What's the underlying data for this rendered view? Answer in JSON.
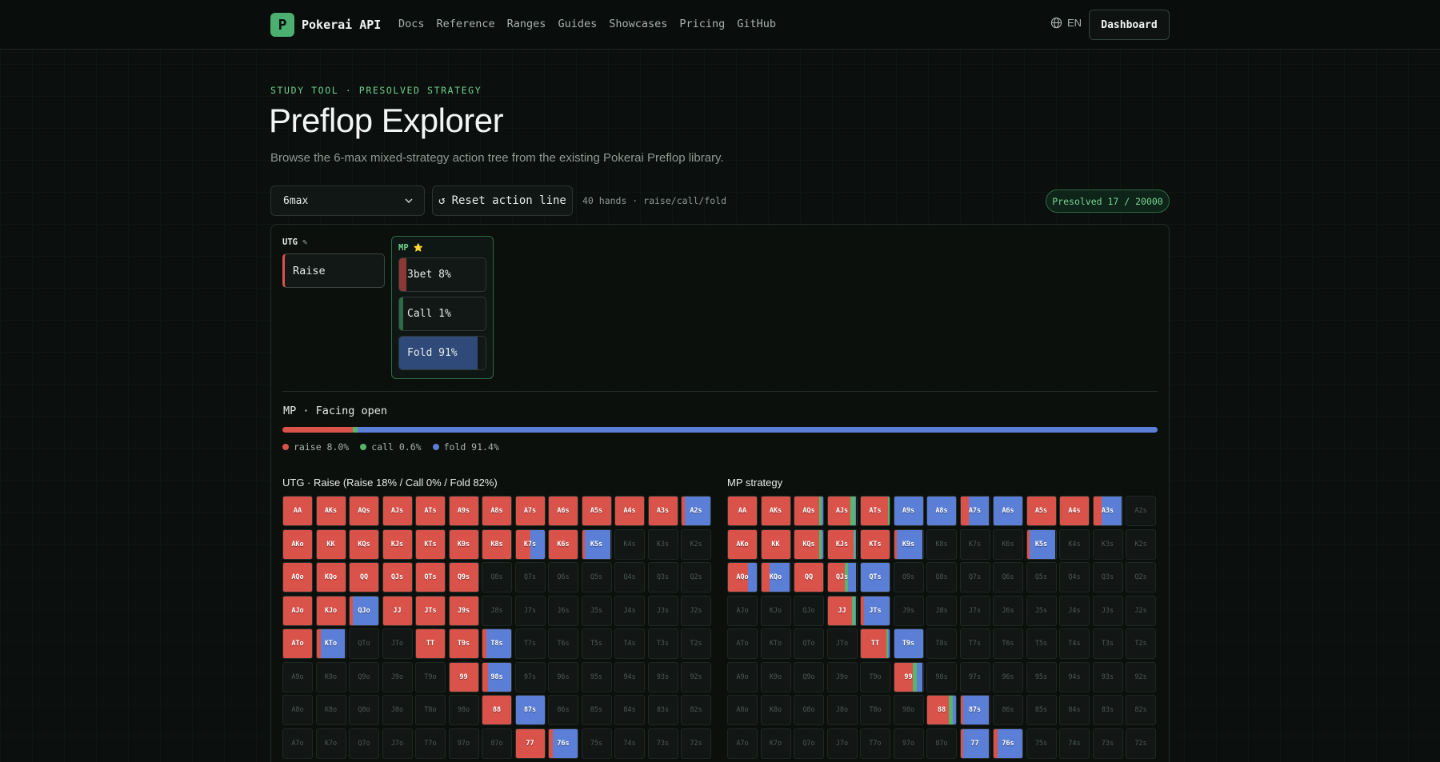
{
  "colors": {
    "raise": "#d9534a",
    "call": "#57b56c",
    "fold": "#5b7fd6",
    "accent": "#4caf72"
  },
  "header": {
    "logo_letter": "P",
    "brand": "Pokerai API",
    "nav": [
      "Docs",
      "Reference",
      "Ranges",
      "Guides",
      "Showcases",
      "Pricing",
      "GitHub"
    ],
    "lang": "EN",
    "dashboard": "Dashboard"
  },
  "hero": {
    "eyebrow": "STUDY TOOL · PRESOLVED STRATEGY",
    "title": "Preflop Explorer",
    "subtitle": "Browse the 6-max mixed-strategy action tree from the existing Pokerai Preflop library."
  },
  "controls": {
    "format": "6max",
    "reset": "Reset action line",
    "hands_info": "40 hands · raise/call/fold",
    "presolved": "Presolved 17 / 20000"
  },
  "tree": {
    "utg": {
      "label": "UTG",
      "edit_icon": "✎",
      "action": "Raise"
    },
    "mp": {
      "label": "MP",
      "star_icon": "⭐",
      "actions": [
        {
          "label": "3bet 8%",
          "type": "raise",
          "freq": 8
        },
        {
          "label": "Call 1%",
          "type": "call",
          "freq": 1
        },
        {
          "label": "Fold 91%",
          "type": "fold",
          "freq": 91
        }
      ]
    }
  },
  "facing": {
    "title": "MP · Facing open",
    "raise": 8.0,
    "call": 0.6,
    "fold": 91.4,
    "legend": [
      "raise 8.0%",
      "call 0.6%",
      "fold 91.4%"
    ]
  },
  "grids": [
    {
      "title": "UTG · Raise (Raise 18% / Call 0% / Fold 82%)",
      "rows": [
        [
          "AA:100:0",
          "AKs:100:0",
          "AQs:100:0",
          "AJs:100:0",
          "ATs:100:0",
          "A9s:100:0",
          "A8s:100:0",
          "A7s:100:0",
          "A6s:100:0",
          "A5s:100:0",
          "A4s:100:0",
          "A3s:100:0",
          "A2s:12:0"
        ],
        [
          "AKo:100:0",
          "KK:100:0",
          "KQs:100:0",
          "KJs:100:0",
          "KTs:100:0",
          "K9s:100:0",
          "K8s:100:0",
          "K7s:50:0",
          "K6s:100:0",
          "K5s:10:0",
          "K4s",
          "K3s",
          "K2s"
        ],
        [
          "AQo:100:0",
          "KQo:100:0",
          "QQ:100:0",
          "QJs:100:0",
          "QTs:100:0",
          "Q9s:100:0",
          "Q8s",
          "Q7s",
          "Q6s",
          "Q5s",
          "Q4s",
          "Q3s",
          "Q2s"
        ],
        [
          "AJo:100:0",
          "KJo:100:0",
          "QJo:10:0",
          "JJ:100:0",
          "JTs:100:0",
          "J9s:100:0",
          "J8s",
          "J7s",
          "J6s",
          "J5s",
          "J4s",
          "J3s",
          "J2s"
        ],
        [
          "ATo:100:0",
          "KTo:15:0",
          "QTo",
          "JTo",
          "TT:100:0",
          "T9s:100:0",
          "T8s:15:0",
          "T7s",
          "T6s",
          "T5s",
          "T4s",
          "T3s",
          "T2s"
        ],
        [
          "A9o",
          "K9o",
          "Q9o",
          "J9o",
          "T9o",
          "99:100:0",
          "98s:20:0",
          "97s",
          "96s",
          "95s",
          "94s",
          "93s",
          "92s"
        ],
        [
          "A8o",
          "K8o",
          "Q8o",
          "J8o",
          "T8o",
          "98o",
          "88:100:0",
          "87s:0:0",
          "86s",
          "85s",
          "84s",
          "83s",
          "82s"
        ],
        [
          "A7o",
          "K7o",
          "Q7o",
          "J7o",
          "T7o",
          "97o",
          "87o",
          "77:100:0",
          "76s:15:0",
          "75s",
          "74s",
          "73s",
          "72s"
        ]
      ]
    },
    {
      "title": "MP strategy",
      "rows": [
        [
          "AA:100:0",
          "AKs:100:0",
          "AQs:85:10",
          "AJs:80:15",
          "ATs:95:5",
          "A9s:0:0",
          "A8s:0:0",
          "A7s:30:0",
          "A6s:0:0",
          "A5s:100:0",
          "A4s:100:0",
          "A3s:30:0",
          "A2s"
        ],
        [
          "AKo:100:0",
          "KK:100:0",
          "KQs:85:10",
          "KJs:90:5",
          "KTs:100:0",
          "K9s:10:0",
          "K8s",
          "K7s",
          "K6s",
          "K5s:10:0",
          "K4s",
          "K3s",
          "K2s"
        ],
        [
          "AQo:70:0",
          "KQo:30:0",
          "QQ:100:0",
          "QJs:60:10",
          "QTs:0:0",
          "Q9s",
          "Q8s",
          "Q7s",
          "Q6s",
          "Q5s",
          "Q4s",
          "Q3s",
          "Q2s"
        ],
        [
          "AJo",
          "KJo",
          "QJo",
          "JJ:85:10",
          "JTs:10:0",
          "J9s",
          "J8s",
          "J7s",
          "J6s",
          "J5s",
          "J4s",
          "J3s",
          "J2s"
        ],
        [
          "ATo",
          "KTo",
          "QTo",
          "JTo",
          "TT:90:5",
          "T9s:0:0",
          "T8s",
          "T7s",
          "T6s",
          "T5s",
          "T4s",
          "T3s",
          "T2s"
        ],
        [
          "A9o",
          "K9o",
          "Q9o",
          "J9o",
          "T9o",
          "99:65:15",
          "98s",
          "97s",
          "96s",
          "95s",
          "94s",
          "93s",
          "92s"
        ],
        [
          "A8o",
          "K8o",
          "Q8o",
          "J8o",
          "T8o",
          "98o",
          "88:75:15",
          "87s:10:0",
          "86s",
          "85s",
          "84s",
          "83s",
          "82s"
        ],
        [
          "A7o",
          "K7o",
          "Q7o",
          "J7o",
          "T7o",
          "97o",
          "87o",
          "77:10:0",
          "76s:15:0",
          "75s",
          "74s",
          "73s",
          "72s"
        ]
      ]
    }
  ]
}
